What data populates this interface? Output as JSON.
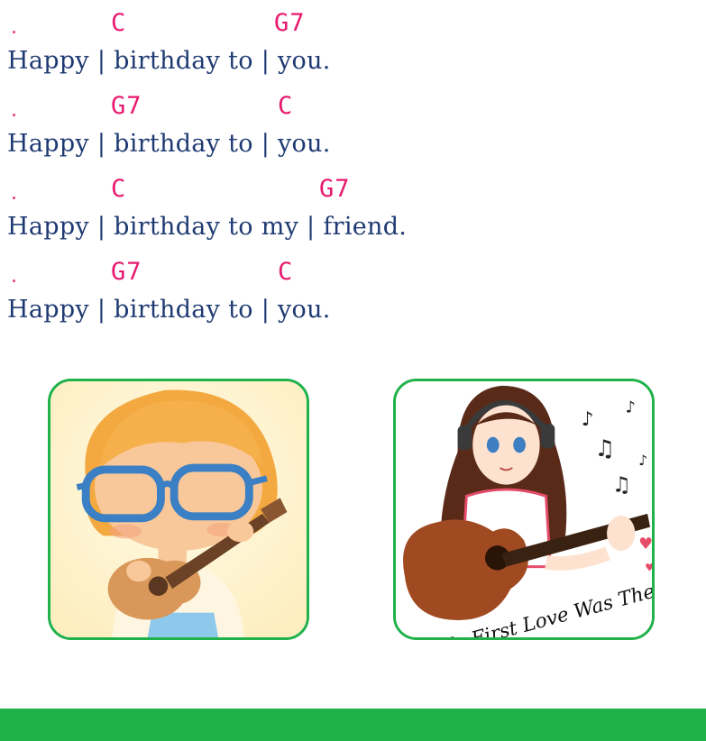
{
  "verses": [
    {
      "dot": ".",
      "chords": [
        {
          "name": "C"
        },
        {
          "name": "G7"
        }
      ],
      "lyric": "Happy | birthday to | you."
    },
    {
      "dot": ".",
      "chords": [
        {
          "name": "G7"
        },
        {
          "name": "C"
        }
      ],
      "lyric": "Happy | birthday to | you."
    },
    {
      "dot": ".",
      "chords": [
        {
          "name": "C"
        },
        {
          "name": "G7"
        }
      ],
      "lyric": "Happy | birthday to my | friend."
    },
    {
      "dot": ".",
      "chords": [
        {
          "name": "G7"
        },
        {
          "name": "C"
        }
      ],
      "lyric": "Happy | birthday to | you."
    }
  ],
  "illustrations": {
    "left": {
      "icon": "girl-with-ukulele"
    },
    "right": {
      "icon": "girl-with-guitar",
      "caption_text": "My First Love Was The"
    }
  },
  "colors": {
    "chord": "#e8196f",
    "lyric": "#1f3a73",
    "accent_green": "#1fb14a"
  }
}
